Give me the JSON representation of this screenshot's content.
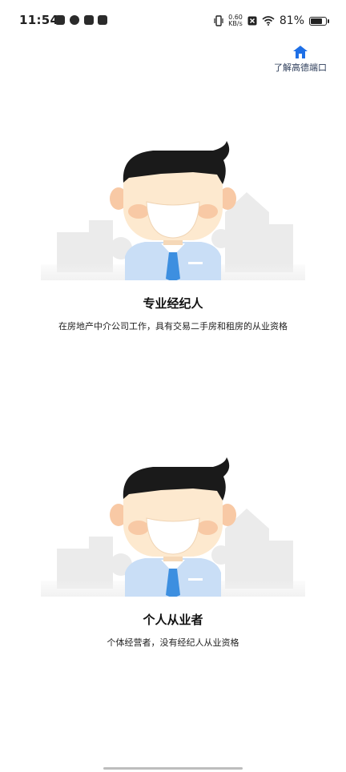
{
  "status_bar": {
    "time": "11:54",
    "net_speed_value": "0.60",
    "net_speed_unit": "KB/s",
    "battery_percent": "81%",
    "battery_level": 0.81
  },
  "header": {
    "learn_link": "了解高德端口"
  },
  "options": [
    {
      "title": "专业经纪人",
      "description": "在房地产中介公司工作，具有交易二手房和租房的从业资格"
    },
    {
      "title": "个人从业者",
      "description": "个体经营者，没有经纪人从业资格"
    }
  ],
  "colors": {
    "link_icon": "#1e6fe6",
    "shirt": "#c9def6",
    "tie": "#3d8fe0",
    "hair": "#1a1a1a",
    "skin": "#fde9cf",
    "cheek": "#f8c9a5",
    "buildings": "#e9e9e9"
  }
}
